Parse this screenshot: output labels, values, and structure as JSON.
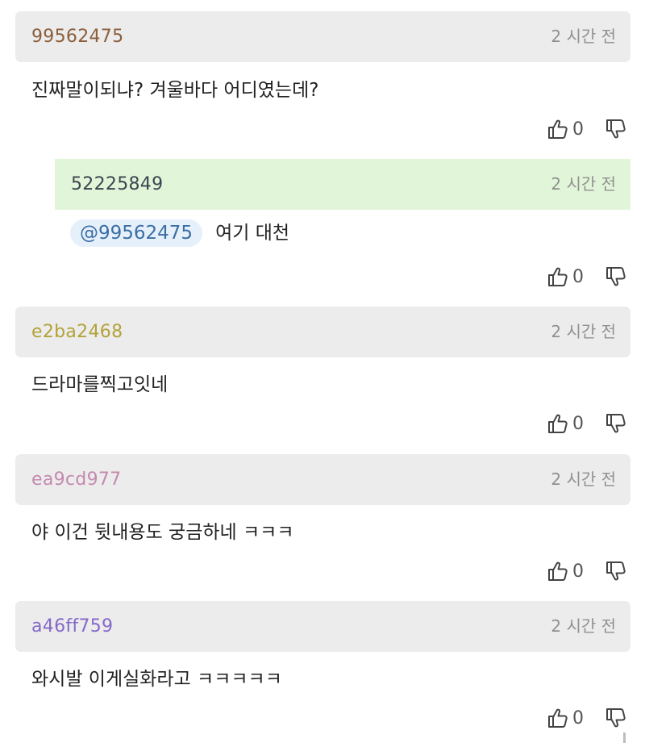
{
  "comments": [
    {
      "author": "99562475",
      "author_color": "#8b5e3c",
      "time": "2 시간 전",
      "mention": "",
      "text": "진짜말이되냐? 겨울바다 어디였는데?",
      "likes": "0"
    },
    {
      "author": "52225849",
      "author_color": "#3d4450",
      "time": "2 시간 전",
      "mention": "@99562475",
      "text": "여기 대천",
      "likes": "0",
      "is_reply": true
    },
    {
      "author": "e2ba2468",
      "author_color": "#b3a23a",
      "time": "2 시간 전",
      "mention": "",
      "text": "드라마를찍고잇네",
      "likes": "0"
    },
    {
      "author": "ea9cd977",
      "author_color": "#c48ab0",
      "time": "2 시간 전",
      "mention": "",
      "text": "야 이건 뒷내용도 궁금하네 ㅋㅋㅋ",
      "likes": "0"
    },
    {
      "author": "a46ff759",
      "author_color": "#8569c9",
      "time": "2 시간 전",
      "mention": "",
      "text": "와시발 이게실화라고 ㅋㅋㅋㅋㅋ",
      "likes": "0"
    }
  ],
  "icons": {
    "like": "thumbs-up-icon",
    "dislike": "thumbs-down-icon"
  }
}
